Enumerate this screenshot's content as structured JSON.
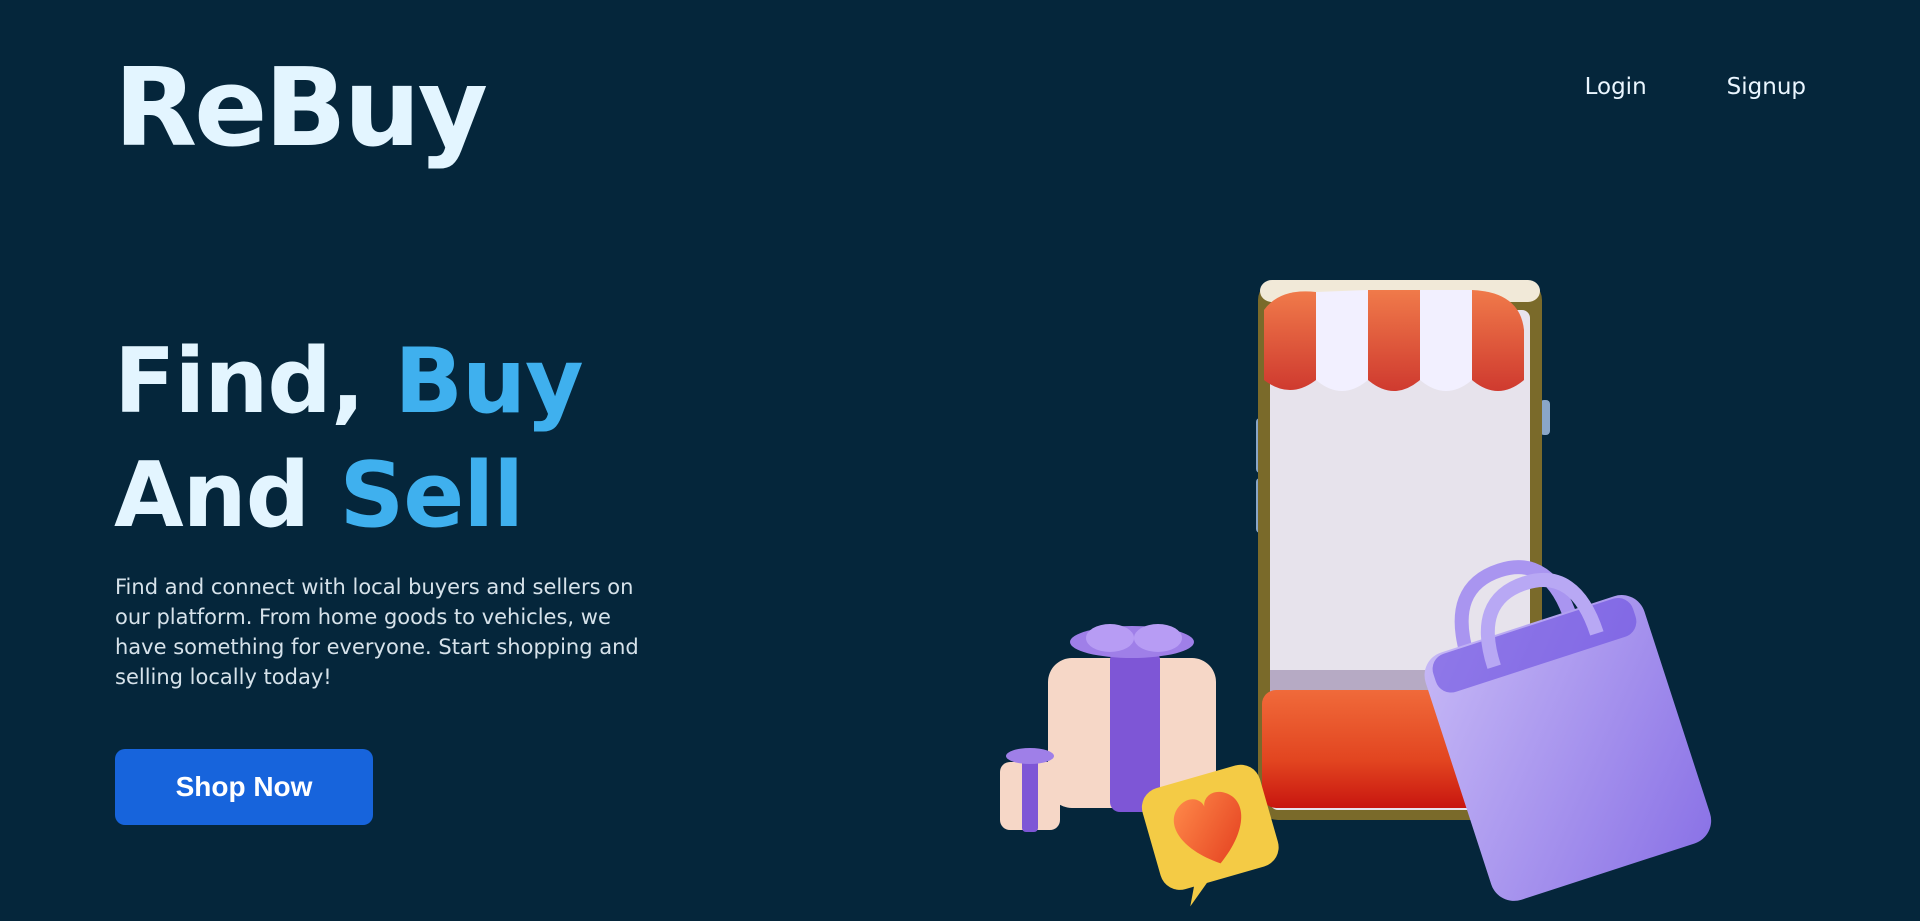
{
  "brand": {
    "name": "ReBuy"
  },
  "nav": {
    "login": "Login",
    "signup": "Signup"
  },
  "hero": {
    "line1_plain": "Find, ",
    "line1_accent": "Buy",
    "line2_plain": "And ",
    "line2_accent": "Sell",
    "description": "Find and connect with local buyers and sellers on our platform. From home goods to vehicles, we have something for everyone. Start shopping and selling locally today!",
    "cta": "Shop Now"
  },
  "illustration": {
    "icons": [
      "phone-store-icon",
      "gift-box-icon",
      "small-gift-icon",
      "heart-bubble-icon",
      "shopping-bag-icon"
    ]
  },
  "colors": {
    "background": "#05263b",
    "accent": "#3fb0ee",
    "button": "#1764dc",
    "text": "#e3f5ff"
  }
}
